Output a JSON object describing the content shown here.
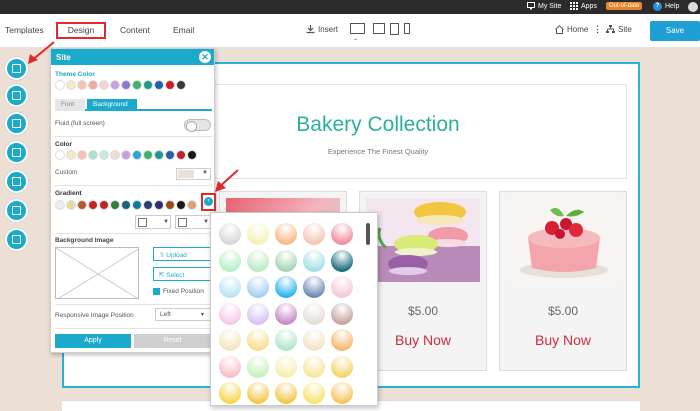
{
  "topbar": {
    "my_site": "My Site",
    "apps": "Apps",
    "badge": "Out-of-date",
    "help": "Help"
  },
  "nav": {
    "templates": "Templates",
    "design": "Design",
    "content": "Content",
    "email": "Email",
    "insert": "Insert",
    "home": "Home",
    "site": "Site",
    "save": "Save"
  },
  "hero": {
    "title": "Bakery Collection",
    "subtitle": "Experience The Finest Quality"
  },
  "products": [
    {
      "price": "$5.00",
      "buy": "Buy Now"
    },
    {
      "price": "$5.00",
      "buy": "Buy Now"
    }
  ],
  "panel": {
    "title": "Site",
    "close": "✕",
    "theme_color_label": "Theme Color",
    "theme_colors": [
      "#ffffff",
      "#f4e9c6",
      "#f7c1b2",
      "#f2a6a6",
      "#f4d3d3",
      "#c6a1e0",
      "#8e75d6",
      "#3fb26c",
      "#1c9b8c",
      "#2260a8",
      "#c81d2c",
      "#3a3a3a"
    ],
    "tab_font": "Font",
    "tab_background": "Background",
    "fluid_label": "Fluid (full screen)",
    "color_label": "Color",
    "colors": [
      "#ffffff",
      "#f4e9c6",
      "#f7c1b2",
      "#a7e3c5",
      "#c8e9e2",
      "#ecdfd5",
      "#c6a1e0",
      "#2da6d8",
      "#3fb26c",
      "#1c9b8c",
      "#2260a8",
      "#c81d2c",
      "#1a1a1a"
    ],
    "custom_label": "Custom",
    "gradient_label": "Gradient",
    "gradients": [
      "#ececec",
      "#e9d8a2",
      "#b65b2b",
      "#c8251e",
      "#b7281f",
      "#2f7f35",
      "#1f5f7b",
      "#0f7a97",
      "#2c3f75",
      "#332d6e",
      "#9a4c1b",
      "#1a1a1a",
      "#e1a06b"
    ],
    "gradient_more": "›",
    "bg_image_label": "Background Image",
    "upload": "Upload",
    "select": "Select",
    "fixed_position": "Fixed Position",
    "responsive_label": "Responsive Image Position",
    "responsive_value": "Left",
    "apply": "Apply",
    "reset": "Reset"
  },
  "gradient_popup": {
    "swatches": [
      "#d7d7d7",
      "#f6f1b7",
      "#f7b987",
      "#f5c6b3",
      "#f18d9c",
      "#b9eec7",
      "#bde9c5",
      "#a7d4b8",
      "#a4e0e1",
      "#1c6f7d",
      "#b9e4f5",
      "#a7cef3",
      "#2ab5f0",
      "#6f89b5",
      "#f5c9d8",
      "#f6c9e6",
      "#d8c3f2",
      "#c78bc4",
      "#e6dcd8",
      "#c6a3a3",
      "#f1e6c1",
      "#f7dd8c",
      "#b3e6c9",
      "#f1e4c7",
      "#f6b86e",
      "#f6bfc6",
      "#c6f1ba",
      "#f3f0ad",
      "#f5e59a",
      "#f1d66a",
      "#f6d64e",
      "#f3c94c",
      "#f2c84d",
      "#f6e26e",
      "#f7c55e"
    ]
  }
}
